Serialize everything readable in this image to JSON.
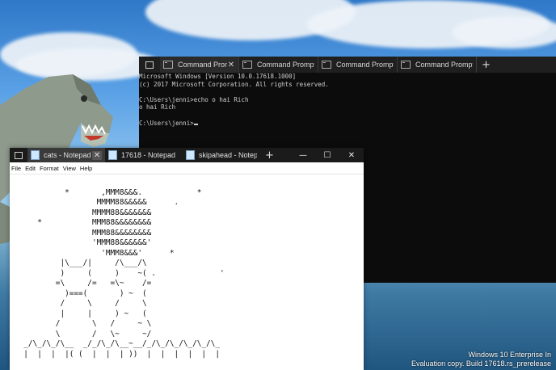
{
  "cmd": {
    "tabs": [
      {
        "label": "Command Prompt",
        "active": true
      },
      {
        "label": "Command Prompt",
        "active": false
      },
      {
        "label": "Command Prompt",
        "active": false
      },
      {
        "label": "Command Prompt",
        "active": false
      }
    ],
    "lines": [
      "Microsoft Windows [Version 10.0.17618.1000]",
      "(c) 2017 Microsoft Corporation. All rights reserved.",
      "",
      "C:\\Users\\jenni>echo o hai Rich",
      "o hai Rich",
      "",
      "C:\\Users\\jenni>"
    ]
  },
  "notepad": {
    "tabs": [
      {
        "label": "cats - Notepad",
        "active": true
      },
      {
        "label": "17618 - Notepad",
        "active": false
      },
      {
        "label": "skipahead - Notepad",
        "active": false
      }
    ],
    "controls": [
      "—",
      "☐",
      "✕"
    ],
    "menu": [
      "File",
      "Edit",
      "Format",
      "View",
      "Help"
    ],
    "text_lines": [
      "",
      "           *       ,MMM8&&&.            *",
      "                  MMMM88&&&&&      .",
      "                 MMMM88&&&&&&&",
      "     *           MMM88&&&&&&&&",
      "                 MMM88&&&&&&&&",
      "                 'MMM88&&&&&&'",
      "                   'MMM8&&&'      *",
      "          |\\___/|     /\\___/\\",
      "          )     (     )    ~( .              '",
      "         =\\     /=   =\\~    /=",
      "           )===(       ) ~  (",
      "          /     \\     /     \\",
      "          |     |     ) ~   (",
      "         /       \\   /     ~ \\",
      "         \\       /   \\~     ~/",
      "  _/\\_/\\_/\\__  _/_/\\_/\\__~__/_/\\_/\\_/\\_/\\_/\\_",
      "  |  |  |  |( (  |  |  | ))  |  |  |  |  |  |"
    ]
  },
  "watermark": {
    "line1": "Windows 10 Enterprise In",
    "line2": "Evaluation copy. Build 17618.rs_prerelease"
  }
}
